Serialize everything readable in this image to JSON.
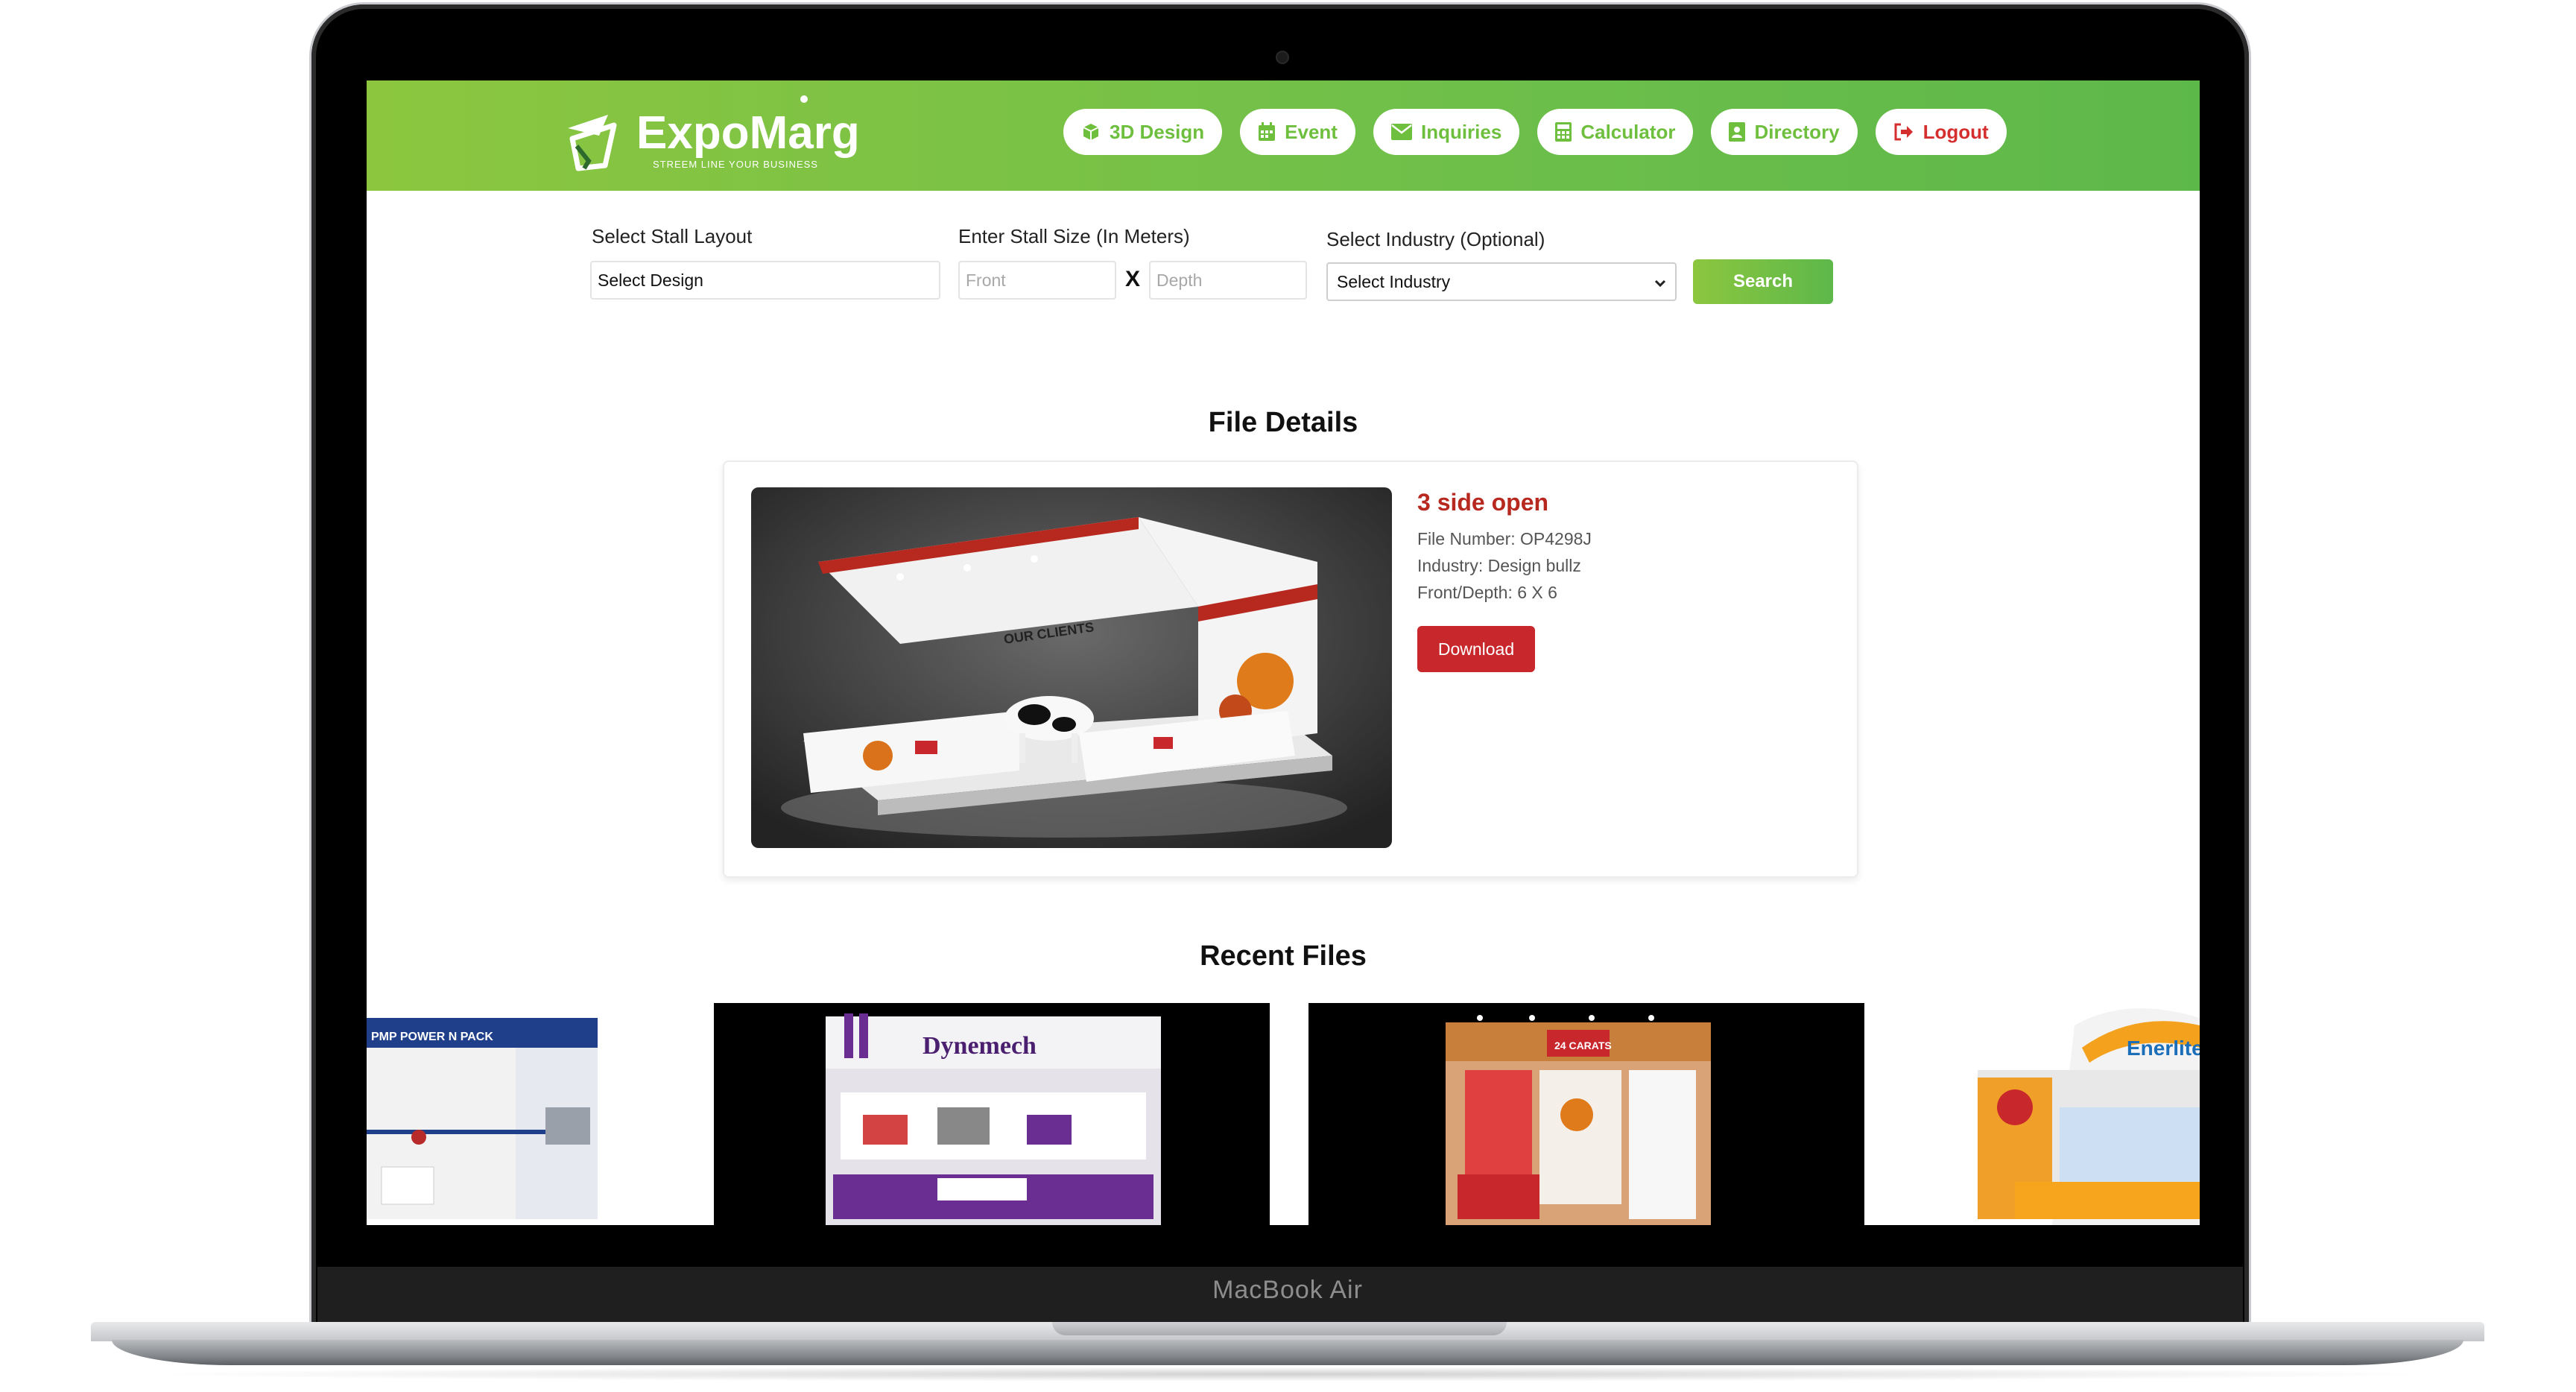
{
  "device": {
    "brand_label": "MacBook Air"
  },
  "app": {
    "logo_name": "ExpoMarg",
    "logo_tagline": "STREEM LINE YOUR BUSINESS"
  },
  "nav": {
    "items": [
      {
        "label": "3D Design",
        "icon": "cube-icon"
      },
      {
        "label": "Event",
        "icon": "calendar-icon"
      },
      {
        "label": "Inquiries",
        "icon": "envelope-icon"
      },
      {
        "label": "Calculator",
        "icon": "calculator-icon"
      },
      {
        "label": "Directory",
        "icon": "address-book-icon"
      },
      {
        "label": "Logout",
        "icon": "sign-out-icon"
      }
    ]
  },
  "search": {
    "layout_label": "Select Stall Layout",
    "layout_value": "Select Design",
    "size_label": "Enter Stall Size (In Meters)",
    "front_placeholder": "Front",
    "depth_placeholder": "Depth",
    "times_symbol": "X",
    "industry_label": "Select Industry (Optional)",
    "industry_value": "Select Industry",
    "button_label": "Search"
  },
  "file_details": {
    "heading": "File Details",
    "title": "3 side open",
    "file_number": "File Number: OP4298J",
    "industry": "Industry: Design bullz",
    "front_depth": "Front/Depth: 6 X 6",
    "download_label": "Download",
    "stall_text_clients": "OUR CLIENTS"
  },
  "recent": {
    "heading": "Recent Files",
    "items": [
      {
        "brand": "PMP POWER N PACK"
      },
      {
        "brand": "Dynemech"
      },
      {
        "brand": "24 CARATS"
      },
      {
        "brand": "Enerlite"
      }
    ]
  },
  "colors": {
    "header_green_start": "#8cc63f",
    "header_green_end": "#5db84a",
    "title_red": "#b7281f",
    "download_red": "#c8272c",
    "logout_red": "#d42e2e"
  }
}
